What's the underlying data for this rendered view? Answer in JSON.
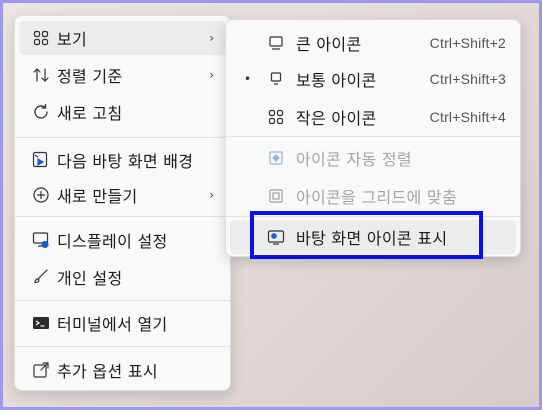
{
  "main_menu": {
    "items": [
      {
        "label": "보기",
        "icon": "grid-view-icon",
        "submenu": true
      },
      {
        "label": "정렬 기준",
        "icon": "sort-arrows-icon",
        "submenu": true
      },
      {
        "label": "새로 고침",
        "icon": "refresh-icon",
        "submenu": false
      },
      {
        "label": "다음 바탕 화면 배경",
        "icon": "next-wallpaper-icon",
        "submenu": false
      },
      {
        "label": "새로 만들기",
        "icon": "new-plus-icon",
        "submenu": true
      },
      {
        "label": "디스플레이 설정",
        "icon": "display-settings-icon",
        "submenu": false
      },
      {
        "label": "개인 설정",
        "icon": "personalize-brush-icon",
        "submenu": false
      },
      {
        "label": "터미널에서 열기",
        "icon": "terminal-icon",
        "submenu": false
      },
      {
        "label": "추가 옵션 표시",
        "icon": "more-options-icon",
        "submenu": false
      }
    ]
  },
  "view_submenu": {
    "items": [
      {
        "label": "큰 아이콘",
        "shortcut": "Ctrl+Shift+2",
        "icon": "monitor-large-icon"
      },
      {
        "label": "보통 아이콘",
        "shortcut": "Ctrl+Shift+3",
        "icon": "monitor-medium-icon",
        "selected": true
      },
      {
        "label": "작은 아이콘",
        "shortcut": "Ctrl+Shift+4",
        "icon": "grid-small-icon"
      },
      {
        "label": "아이콘 자동 정렬",
        "icon": "auto-arrange-icon",
        "disabled": true
      },
      {
        "label": "아이콘을 그리드에 맞춤",
        "icon": "align-grid-icon",
        "disabled": true
      },
      {
        "label": "바탕 화면 아이콘 표시",
        "icon": "show-desktop-icons-icon",
        "highlighted": true
      }
    ],
    "bullet": "•"
  },
  "chevron": "›",
  "highlight_color": "#0a10e6"
}
